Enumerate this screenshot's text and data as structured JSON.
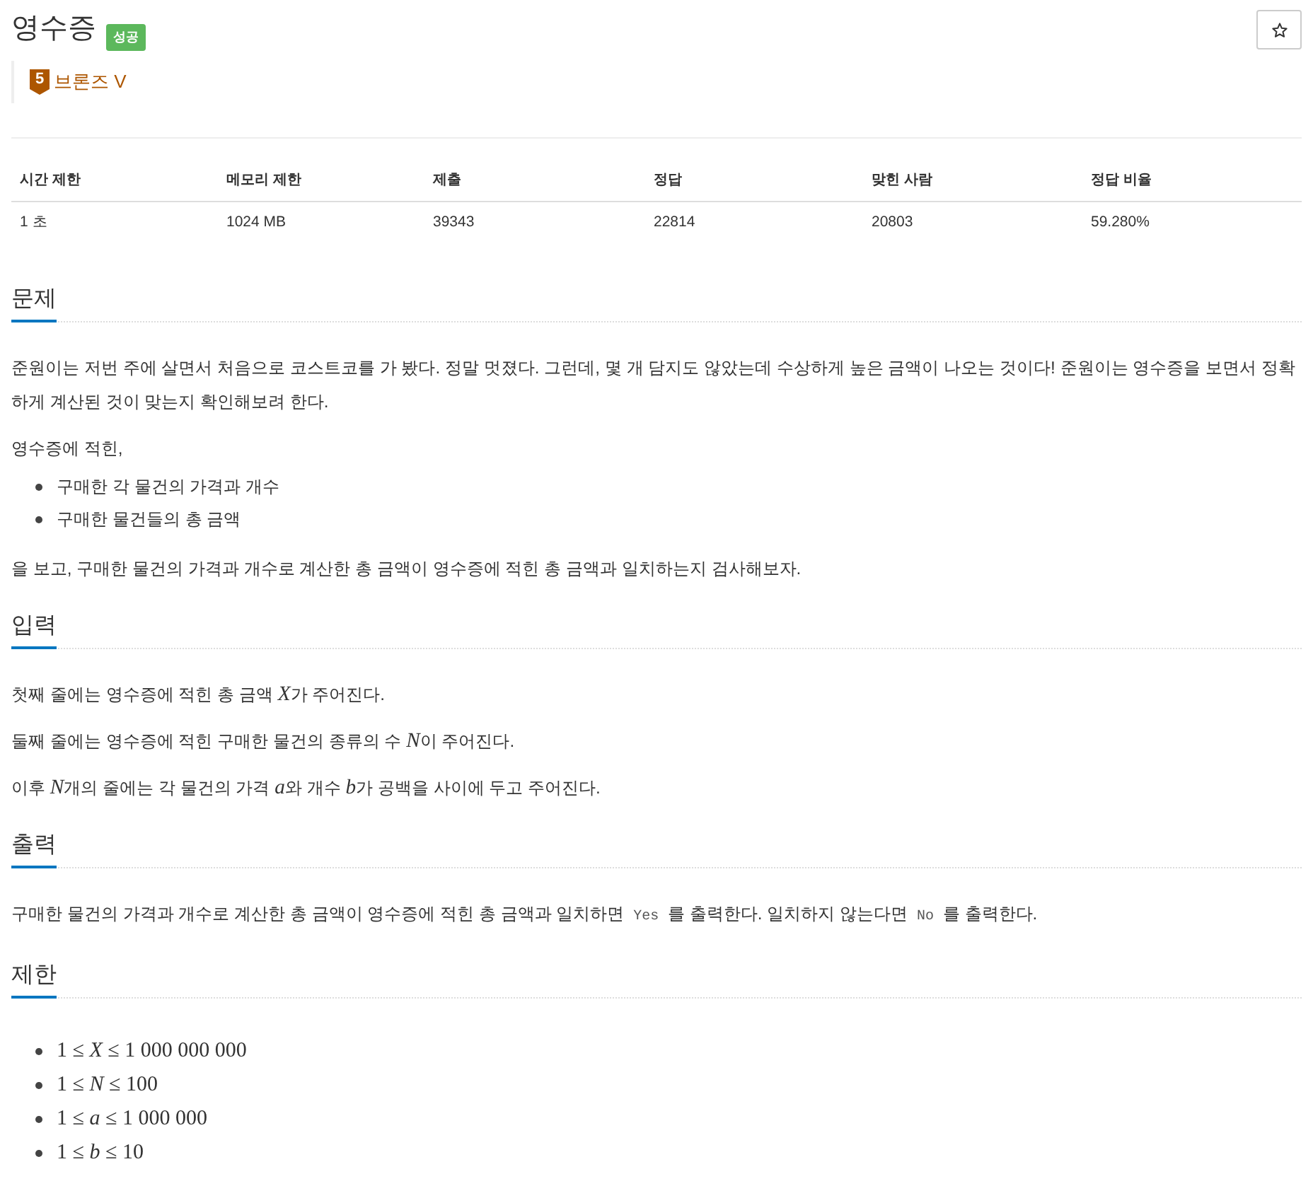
{
  "problem": {
    "title": "영수증",
    "result_badge": "성공",
    "starred": false,
    "tier": {
      "badge": "5",
      "name": "브론즈 V"
    }
  },
  "info_table": {
    "columns": [
      "시간 제한",
      "메모리 제한",
      "제출",
      "정답",
      "맞힌 사람",
      "정답 비율"
    ],
    "rows": [
      [
        "1 초",
        "1024 MB",
        "39343",
        "22814",
        "20803",
        "59.280%"
      ]
    ]
  },
  "sections": [
    {
      "heading": "문제",
      "blocks": [
        {
          "kind": "paragraph",
          "text": "준원이는 저번 주에 살면서 처음으로 코스트코를 가 봤다. 정말 멋졌다. 그런데, 몇 개 담지도 않았는데 수상하게 높은 금액이 나오는 것이다! 준원이는 영수증을 보면서 정확하게 계산된 것이 맞는지 확인해보려 한다."
        },
        {
          "kind": "paragraph",
          "text": "영수증에 적힌,"
        },
        {
          "kind": "list",
          "items": [
            "구매한 각 물건의 가격과 개수",
            "구매한 물건들의 총 금액"
          ]
        },
        {
          "kind": "paragraph",
          "text": "을 보고, 구매한 물건의 가격과 개수로 계산한 총 금액이 영수증에 적힌 총 금액과 일치하는지 검사해보자."
        }
      ]
    },
    {
      "heading": "입력",
      "blocks": [
        {
          "kind": "mixed",
          "parts": [
            {
              "kind": "text",
              "text": "첫째 줄에는 영수증에 적힌 총 금액 "
            },
            {
              "kind": "math",
              "text": "X"
            },
            {
              "kind": "text",
              "text": "가 주어진다."
            }
          ]
        },
        {
          "kind": "mixed",
          "parts": [
            {
              "kind": "text",
              "text": "둘째 줄에는 영수증에 적힌 구매한 물건의 종류의 수 "
            },
            {
              "kind": "math",
              "text": "N"
            },
            {
              "kind": "text",
              "text": "이 주어진다."
            }
          ]
        },
        {
          "kind": "mixed",
          "parts": [
            {
              "kind": "text",
              "text": "이후 "
            },
            {
              "kind": "math",
              "text": "N"
            },
            {
              "kind": "text",
              "text": "개의 줄에는 각 물건의 가격 "
            },
            {
              "kind": "math",
              "text": "a"
            },
            {
              "kind": "text",
              "text": "와 개수 "
            },
            {
              "kind": "math",
              "text": "b"
            },
            {
              "kind": "text",
              "text": "가 공백을 사이에 두고 주어진다."
            }
          ]
        }
      ]
    },
    {
      "heading": "출력",
      "blocks": [
        {
          "kind": "mixed",
          "parts": [
            {
              "kind": "text",
              "text": "구매한 물건의 가격과 개수로 계산한 총 금액이 영수증에 적힌 총 금액과 일치하면 "
            },
            {
              "kind": "code",
              "text": "Yes"
            },
            {
              "kind": "text",
              "text": " 를 출력한다. 일치하지 않는다면 "
            },
            {
              "kind": "code",
              "text": "No"
            },
            {
              "kind": "text",
              "text": " 를 출력한다."
            }
          ]
        }
      ]
    },
    {
      "heading": "제한",
      "blocks": [
        {
          "kind": "math_list",
          "items": [
            "1 ≤ *X* ≤ 1 000 000 000",
            "1 ≤ *N* ≤ 100",
            "1 ≤ *a* ≤ 1 000 000",
            "1 ≤ *b* ≤ 10"
          ]
        }
      ]
    }
  ]
}
